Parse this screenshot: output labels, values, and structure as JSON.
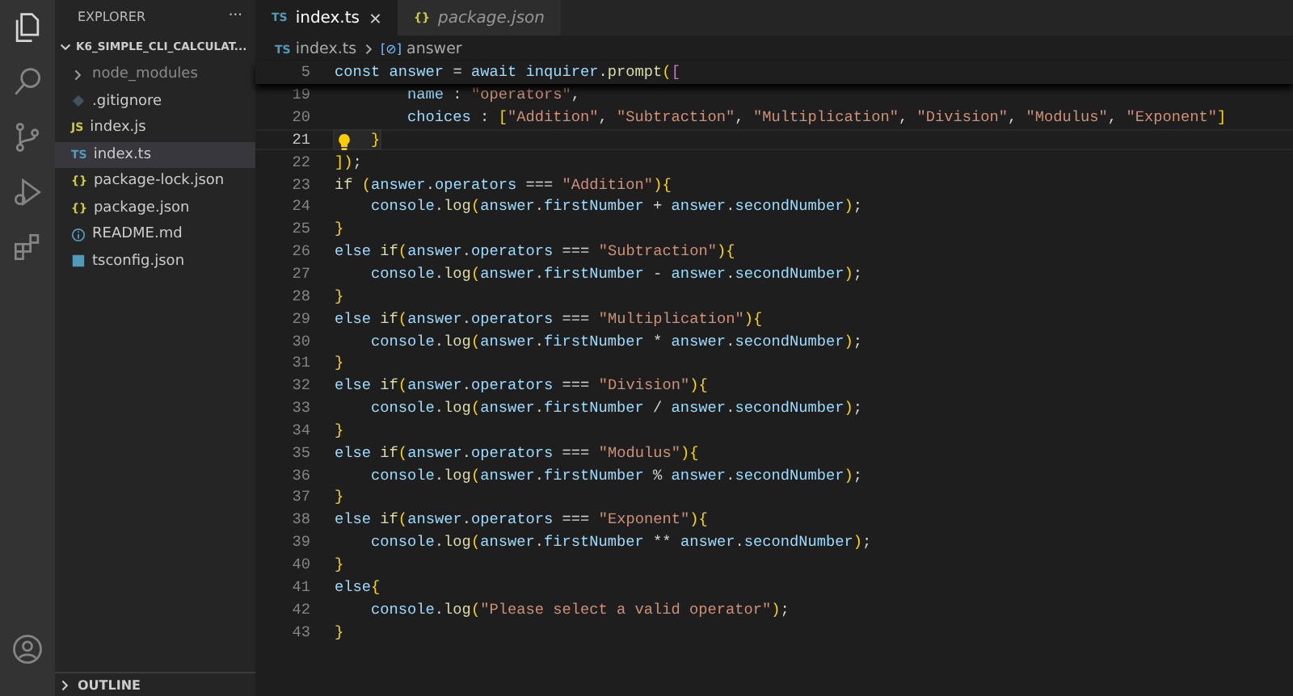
{
  "sidebar": {
    "title": "EXPLORER",
    "more": "···",
    "root": {
      "name": "K6_SIMPLE_CLI_CALCULAT...",
      "expanded": true
    },
    "items": [
      {
        "name": "node_modules",
        "kind": "folder",
        "selected": false,
        "dimmed": true
      },
      {
        "name": ".gitignore",
        "kind": "git",
        "selected": false,
        "dimmed": false
      },
      {
        "name": "index.js",
        "kind": "js",
        "badge": "JS",
        "selected": false,
        "dimmed": false
      },
      {
        "name": "index.ts",
        "kind": "ts",
        "badge": "TS",
        "selected": true,
        "dimmed": false
      },
      {
        "name": "package-lock.json",
        "kind": "json",
        "badge": "{}",
        "selected": false,
        "dimmed": false
      },
      {
        "name": "package.json",
        "kind": "json",
        "badge": "{}",
        "selected": false,
        "dimmed": false
      },
      {
        "name": "README.md",
        "kind": "info",
        "selected": false,
        "dimmed": false
      },
      {
        "name": "tsconfig.json",
        "kind": "tsconfig",
        "selected": false,
        "dimmed": false
      }
    ],
    "outline": {
      "title": "OUTLINE",
      "expanded": false
    }
  },
  "tabs": [
    {
      "label": "index.ts",
      "kind": "ts",
      "badge": "TS",
      "selected": true,
      "preview": false
    },
    {
      "label": "package.json",
      "kind": "json",
      "badge": "{}",
      "selected": false,
      "preview": true
    }
  ],
  "breadcrumb": {
    "file": {
      "badge": "TS",
      "label": "index.ts"
    },
    "symbol": {
      "badge": "[⊘]",
      "label": "answer"
    }
  },
  "sticky_line": {
    "number": "5",
    "text": "const answer = await inquirer.prompt(["
  },
  "lines": [
    {
      "number": "19",
      "current": false,
      "text": "        name : \"operators\","
    },
    {
      "number": "20",
      "current": false,
      "text": "        choices : [\"Addition\", \"Subtraction\", \"Multiplication\", \"Division\", \"Modulus\", \"Exponent\"]"
    },
    {
      "number": "21",
      "current": true,
      "text": "    }"
    },
    {
      "number": "22",
      "current": false,
      "text": "]);"
    },
    {
      "number": "23",
      "current": false,
      "text": "if (answer.operators === \"Addition\"){"
    },
    {
      "number": "24",
      "current": false,
      "text": "    console.log(answer.firstNumber + answer.secondNumber);"
    },
    {
      "number": "25",
      "current": false,
      "text": "}"
    },
    {
      "number": "26",
      "current": false,
      "text": "else if(answer.operators === \"Subtraction\"){"
    },
    {
      "number": "27",
      "current": false,
      "text": "    console.log(answer.firstNumber - answer.secondNumber);"
    },
    {
      "number": "28",
      "current": false,
      "text": "}"
    },
    {
      "number": "29",
      "current": false,
      "text": "else if(answer.operators === \"Multiplication\"){"
    },
    {
      "number": "30",
      "current": false,
      "text": "    console.log(answer.firstNumber * answer.secondNumber);"
    },
    {
      "number": "31",
      "current": false,
      "text": "}"
    },
    {
      "number": "32",
      "current": false,
      "text": "else if(answer.operators === \"Division\"){"
    },
    {
      "number": "33",
      "current": false,
      "text": "    console.log(answer.firstNumber / answer.secondNumber);"
    },
    {
      "number": "34",
      "current": false,
      "text": "}"
    },
    {
      "number": "35",
      "current": false,
      "text": "else if(answer.operators === \"Modulus\"){"
    },
    {
      "number": "36",
      "current": false,
      "text": "    console.log(answer.firstNumber % answer.secondNumber);"
    },
    {
      "number": "37",
      "current": false,
      "text": "}"
    },
    {
      "number": "38",
      "current": false,
      "text": "else if(answer.operators === \"Exponent\"){"
    },
    {
      "number": "39",
      "current": false,
      "text": "    console.log(answer.firstNumber ** answer.secondNumber);"
    },
    {
      "number": "40",
      "current": false,
      "text": "}"
    },
    {
      "number": "41",
      "current": false,
      "text": "else{"
    },
    {
      "number": "42",
      "current": false,
      "text": "    console.log(\"Please select a valid operator\");"
    },
    {
      "number": "43",
      "current": false,
      "text": "}"
    }
  ]
}
